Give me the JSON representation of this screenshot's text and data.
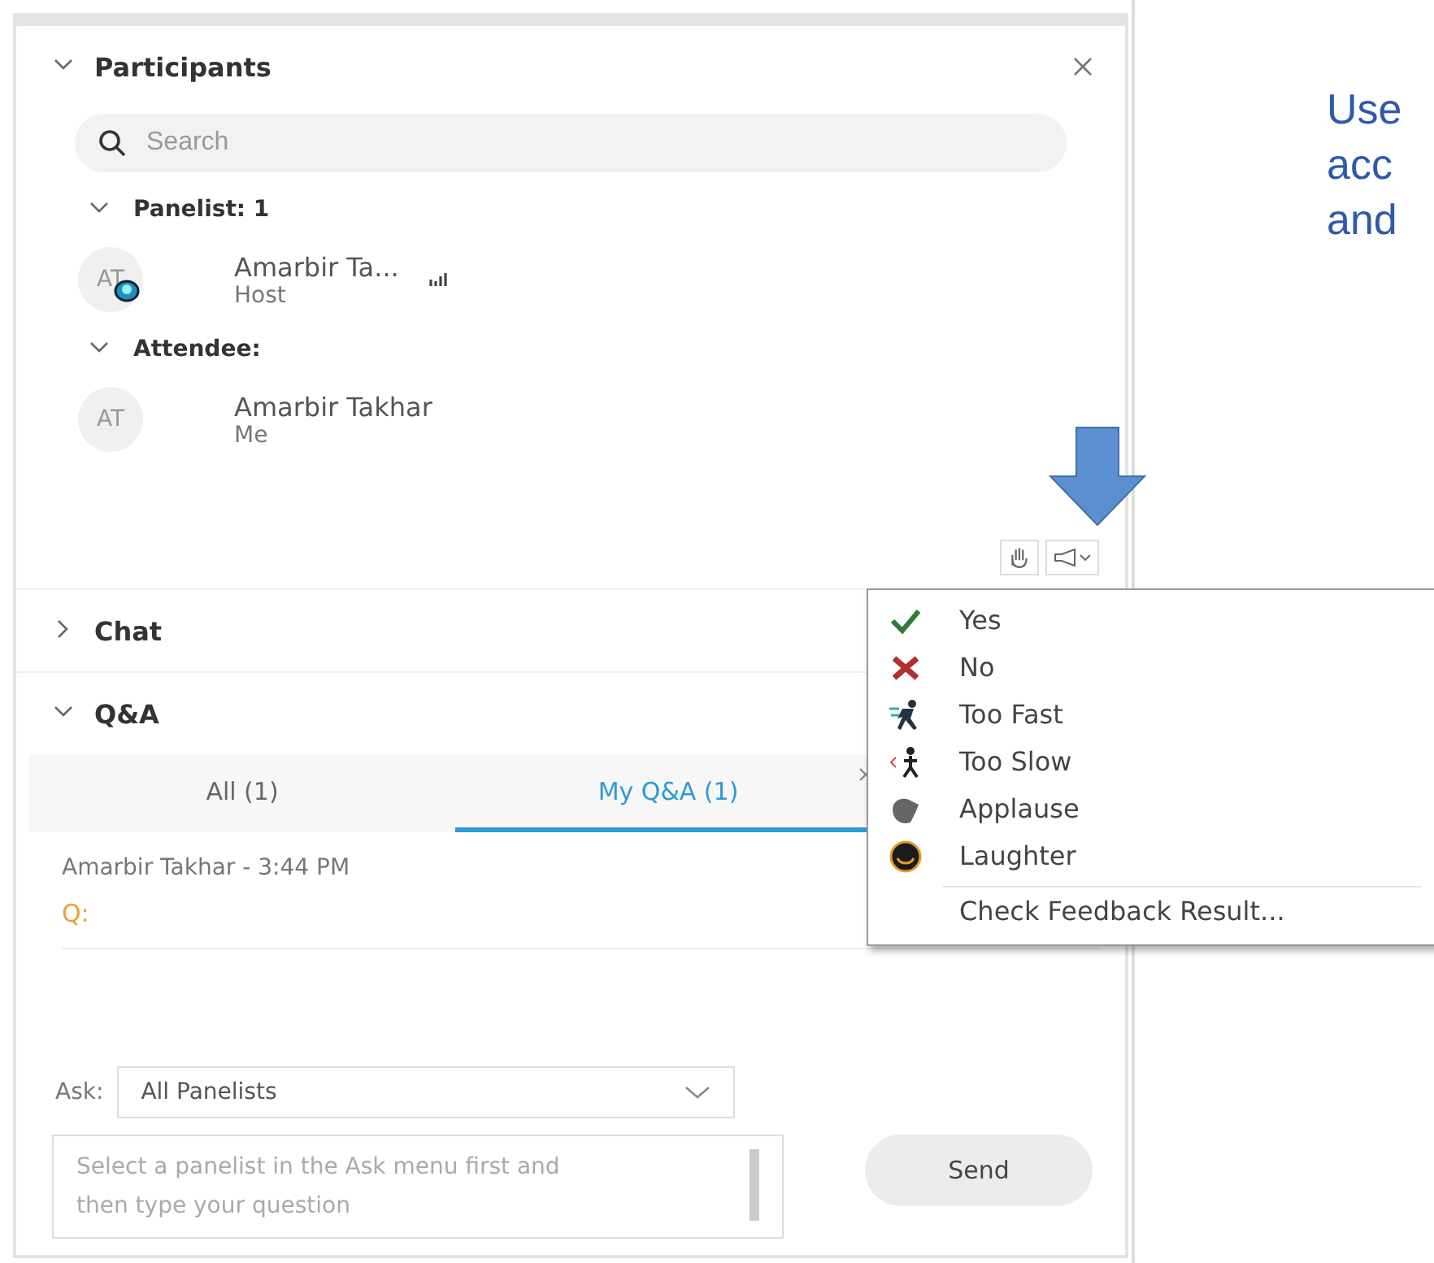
{
  "participants": {
    "title": "Participants",
    "expanded": true,
    "search": {
      "placeholder": "Search"
    },
    "groups": [
      {
        "label": "Panelist: 1",
        "expanded": true,
        "people": [
          {
            "initials": "AT",
            "name": "Amarbir Ta...",
            "role": "Host",
            "host": true
          }
        ]
      },
      {
        "label": "Attendee:",
        "expanded": true,
        "people": [
          {
            "initials": "AT",
            "name": "Amarbir Takhar",
            "role": "Me",
            "host": false
          }
        ]
      }
    ]
  },
  "chat": {
    "title": "Chat",
    "expanded": false
  },
  "qa": {
    "title": "Q&A",
    "expanded": true,
    "tabs": [
      {
        "label": "All (1)",
        "selected": false
      },
      {
        "label": "My Q&A (1)",
        "selected": true
      }
    ],
    "entry": {
      "meta": "Amarbir Takhar - 3:44 PM",
      "question": "Q:"
    },
    "ask_label": "Ask:",
    "ask_value": "All Panelists",
    "placeholder": "Select a panelist in the Ask menu first and then type your question",
    "send": "Send"
  },
  "feedback_menu": [
    {
      "kind": "yes",
      "label": "Yes"
    },
    {
      "kind": "no",
      "label": "No"
    },
    {
      "kind": "fast",
      "label": "Too Fast"
    },
    {
      "kind": "slow",
      "label": "Too Slow"
    },
    {
      "kind": "applause",
      "label": "Applause"
    },
    {
      "kind": "laugh",
      "label": "Laughter"
    },
    {
      "kind": "action",
      "label": "Check Feedback Result..."
    }
  ],
  "side_text": [
    "Use",
    "acc",
    "and"
  ]
}
